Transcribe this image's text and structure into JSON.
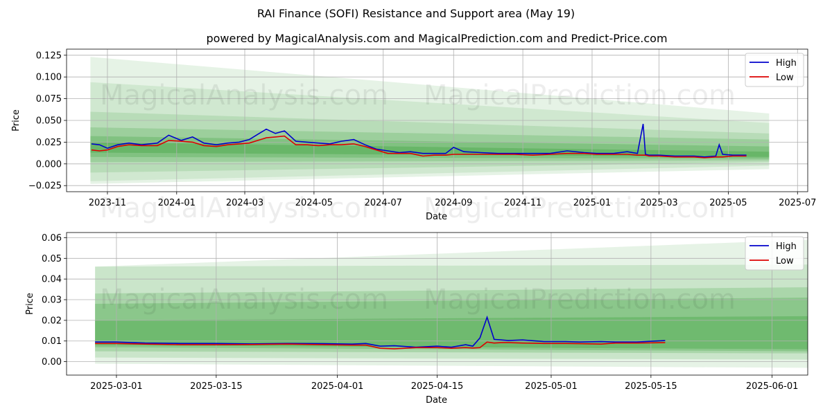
{
  "suptitle": "RAI Finance (SOFI) Resistance and Support area (May 19)",
  "colors": {
    "high": "#0000cc",
    "low": "#dd0000",
    "band": "#2e9b2e",
    "grid": "#b0b0b0"
  },
  "watermarks": [
    "MagicalAnalysis.com",
    "MagicalPrediction.com"
  ],
  "chart_data": [
    {
      "type": "line",
      "title": "powered by MagicalAnalysis.com and MagicalPrediction.com and Predict-Price.com",
      "xlabel": "Date",
      "ylabel": "Price",
      "xlim": [
        "2023-09-26",
        "2025-07-10"
      ],
      "ylim": [
        -0.032,
        0.132
      ],
      "grid": true,
      "legend": "top-right",
      "xticks": [
        "2023-11",
        "2024-01",
        "2024-03",
        "2024-05",
        "2024-07",
        "2024-09",
        "2024-11",
        "2025-01",
        "2025-03",
        "2025-05",
        "2025-07"
      ],
      "yticks": [
        "−0.025",
        "0.000",
        "0.025",
        "0.050",
        "0.075",
        "0.100",
        "0.125"
      ],
      "ytick_values": [
        -0.025,
        0,
        0.025,
        0.05,
        0.075,
        0.1,
        0.125
      ],
      "series": [
        {
          "name": "High",
          "x": [
            "2023-10-18",
            "2023-10-25",
            "2023-11-01",
            "2023-11-10",
            "2023-11-20",
            "2023-12-01",
            "2023-12-15",
            "2023-12-25",
            "2024-01-05",
            "2024-01-15",
            "2024-01-25",
            "2024-02-05",
            "2024-02-15",
            "2024-02-25",
            "2024-03-05",
            "2024-03-15",
            "2024-03-20",
            "2024-03-28",
            "2024-04-05",
            "2024-04-15",
            "2024-04-25",
            "2024-05-05",
            "2024-05-15",
            "2024-05-25",
            "2024-06-05",
            "2024-06-15",
            "2024-06-25",
            "2024-07-05",
            "2024-07-15",
            "2024-07-25",
            "2024-08-05",
            "2024-08-15",
            "2024-08-25",
            "2024-09-01",
            "2024-09-10",
            "2024-09-25",
            "2024-10-10",
            "2024-10-25",
            "2024-11-10",
            "2024-11-25",
            "2024-12-10",
            "2024-12-25",
            "2025-01-05",
            "2025-01-20",
            "2025-02-01",
            "2025-02-10",
            "2025-02-15",
            "2025-02-17",
            "2025-02-20",
            "2025-03-01",
            "2025-03-15",
            "2025-04-01",
            "2025-04-10",
            "2025-04-20",
            "2025-04-23",
            "2025-04-26",
            "2025-05-05",
            "2025-05-17"
          ],
          "values": [
            0.023,
            0.022,
            0.018,
            0.022,
            0.024,
            0.022,
            0.024,
            0.033,
            0.027,
            0.031,
            0.024,
            0.022,
            0.024,
            0.025,
            0.028,
            0.036,
            0.04,
            0.035,
            0.038,
            0.026,
            0.025,
            0.024,
            0.023,
            0.026,
            0.028,
            0.022,
            0.017,
            0.015,
            0.013,
            0.014,
            0.012,
            0.012,
            0.012,
            0.019,
            0.014,
            0.013,
            0.012,
            0.012,
            0.012,
            0.012,
            0.015,
            0.013,
            0.012,
            0.012,
            0.014,
            0.012,
            0.046,
            0.011,
            0.01,
            0.01,
            0.009,
            0.009,
            0.008,
            0.009,
            0.022,
            0.011,
            0.01,
            0.01
          ]
        },
        {
          "name": "Low",
          "x": [
            "2023-10-18",
            "2023-10-25",
            "2023-11-01",
            "2023-11-10",
            "2023-11-20",
            "2023-12-01",
            "2023-12-15",
            "2023-12-25",
            "2024-01-05",
            "2024-01-15",
            "2024-01-25",
            "2024-02-05",
            "2024-02-15",
            "2024-02-25",
            "2024-03-05",
            "2024-03-15",
            "2024-03-20",
            "2024-03-28",
            "2024-04-05",
            "2024-04-15",
            "2024-04-25",
            "2024-05-05",
            "2024-05-15",
            "2024-05-25",
            "2024-06-05",
            "2024-06-15",
            "2024-06-25",
            "2024-07-05",
            "2024-07-15",
            "2024-07-25",
            "2024-08-05",
            "2024-08-15",
            "2024-08-25",
            "2024-09-01",
            "2024-09-10",
            "2024-09-25",
            "2024-10-10",
            "2024-10-25",
            "2024-11-10",
            "2024-11-25",
            "2024-12-10",
            "2024-12-25",
            "2025-01-05",
            "2025-01-20",
            "2025-02-01",
            "2025-02-10",
            "2025-02-15",
            "2025-02-17",
            "2025-02-20",
            "2025-03-01",
            "2025-03-15",
            "2025-04-01",
            "2025-04-10",
            "2025-04-20",
            "2025-04-23",
            "2025-04-26",
            "2025-05-05",
            "2025-05-17"
          ],
          "values": [
            0.016,
            0.015,
            0.016,
            0.02,
            0.022,
            0.021,
            0.021,
            0.027,
            0.026,
            0.025,
            0.021,
            0.02,
            0.022,
            0.023,
            0.024,
            0.028,
            0.03,
            0.031,
            0.032,
            0.022,
            0.022,
            0.021,
            0.022,
            0.022,
            0.023,
            0.02,
            0.016,
            0.012,
            0.012,
            0.012,
            0.009,
            0.01,
            0.01,
            0.011,
            0.011,
            0.011,
            0.011,
            0.011,
            0.01,
            0.011,
            0.012,
            0.012,
            0.011,
            0.011,
            0.011,
            0.01,
            0.01,
            0.01,
            0.009,
            0.009,
            0.008,
            0.008,
            0.007,
            0.008,
            0.008,
            0.008,
            0.009,
            0.009
          ]
        }
      ],
      "bands": [
        {
          "x0": "2023-10-17",
          "x1": "2025-06-06",
          "top": [
            0.123,
            0.058
          ],
          "bottom": [
            -0.023,
            -0.006
          ],
          "opacity": 0.12
        },
        {
          "x0": "2023-10-17",
          "x1": "2025-06-06",
          "top": [
            0.094,
            0.047
          ],
          "bottom": [
            -0.02,
            -0.002
          ],
          "opacity": 0.12
        },
        {
          "x0": "2023-10-17",
          "x1": "2025-06-06",
          "top": [
            0.06,
            0.035
          ],
          "bottom": [
            -0.01,
            0.002
          ],
          "opacity": 0.15
        },
        {
          "x0": "2023-10-17",
          "x1": "2025-06-06",
          "top": [
            0.042,
            0.028
          ],
          "bottom": [
            0.002,
            0.004
          ],
          "opacity": 0.2
        },
        {
          "x0": "2023-10-17",
          "x1": "2025-06-06",
          "top": [
            0.032,
            0.02
          ],
          "bottom": [
            0.008,
            0.006
          ],
          "opacity": 0.25
        },
        {
          "x0": "2023-10-17",
          "x1": "2025-06-06",
          "top": [
            0.025,
            0.014
          ],
          "bottom": [
            0.013,
            0.008
          ],
          "opacity": 0.3
        }
      ]
    },
    {
      "type": "line",
      "title": "",
      "xlabel": "Date",
      "ylabel": "Price",
      "xlim": [
        "2025-02-22",
        "2025-06-06"
      ],
      "ylim": [
        -0.0065,
        0.0625
      ],
      "grid": true,
      "legend": "top-right",
      "xticks": [
        "2025-03-01",
        "2025-03-15",
        "2025-04-01",
        "2025-04-15",
        "2025-05-01",
        "2025-05-15",
        "2025-06-01"
      ],
      "yticks": [
        "0.00",
        "0.01",
        "0.02",
        "0.03",
        "0.04",
        "0.05",
        "0.06"
      ],
      "ytick_values": [
        0,
        0.01,
        0.02,
        0.03,
        0.04,
        0.05,
        0.06
      ],
      "series": [
        {
          "name": "High",
          "x": [
            "2025-02-26",
            "2025-03-01",
            "2025-03-05",
            "2025-03-10",
            "2025-03-15",
            "2025-03-20",
            "2025-03-25",
            "2025-03-30",
            "2025-04-03",
            "2025-04-05",
            "2025-04-07",
            "2025-04-09",
            "2025-04-12",
            "2025-04-15",
            "2025-04-17",
            "2025-04-19",
            "2025-04-20",
            "2025-04-21",
            "2025-04-22",
            "2025-04-23",
            "2025-04-24",
            "2025-04-25",
            "2025-04-27",
            "2025-04-30",
            "2025-05-03",
            "2025-05-05",
            "2025-05-08",
            "2025-05-10",
            "2025-05-13",
            "2025-05-17"
          ],
          "values": [
            0.0095,
            0.0095,
            0.009,
            0.0088,
            0.0088,
            0.0086,
            0.0088,
            0.0087,
            0.0085,
            0.0088,
            0.0075,
            0.0077,
            0.007,
            0.0075,
            0.007,
            0.0082,
            0.0075,
            0.0115,
            0.0215,
            0.0108,
            0.0105,
            0.0102,
            0.0105,
            0.0097,
            0.0097,
            0.0095,
            0.0097,
            0.0095,
            0.0095,
            0.0102
          ]
        },
        {
          "name": "Low",
          "x": [
            "2025-02-26",
            "2025-03-01",
            "2025-03-05",
            "2025-03-10",
            "2025-03-15",
            "2025-03-20",
            "2025-03-25",
            "2025-03-30",
            "2025-04-03",
            "2025-04-05",
            "2025-04-07",
            "2025-04-09",
            "2025-04-12",
            "2025-04-15",
            "2025-04-17",
            "2025-04-19",
            "2025-04-20",
            "2025-04-21",
            "2025-04-22",
            "2025-04-23",
            "2025-04-24",
            "2025-04-25",
            "2025-04-27",
            "2025-04-30",
            "2025-05-03",
            "2025-05-05",
            "2025-05-08",
            "2025-05-10",
            "2025-05-13",
            "2025-05-17"
          ],
          "values": [
            0.0088,
            0.0088,
            0.0085,
            0.0082,
            0.0082,
            0.0083,
            0.0085,
            0.0082,
            0.008,
            0.008,
            0.0065,
            0.0062,
            0.0068,
            0.0068,
            0.0065,
            0.0068,
            0.0066,
            0.0068,
            0.0095,
            0.009,
            0.0092,
            0.0092,
            0.009,
            0.0088,
            0.0088,
            0.0087,
            0.0085,
            0.009,
            0.009,
            0.0092
          ]
        }
      ],
      "bands": [
        {
          "x0": "2025-02-26",
          "x1": "2025-06-06",
          "top": [
            0.046,
            0.059
          ],
          "bottom": [
            -0.001,
            -0.003
          ],
          "opacity": 0.12
        },
        {
          "x0": "2025-02-26",
          "x1": "2025-06-06",
          "top": [
            0.046,
            0.047
          ],
          "bottom": [
            0.002,
            0.001
          ],
          "opacity": 0.15
        },
        {
          "x0": "2025-02-26",
          "x1": "2025-06-06",
          "top": [
            0.033,
            0.036
          ],
          "bottom": [
            0.005,
            0.004
          ],
          "opacity": 0.2
        },
        {
          "x0": "2025-02-26",
          "x1": "2025-06-06",
          "top": [
            0.028,
            0.031
          ],
          "bottom": [
            0.007,
            0.005
          ],
          "opacity": 0.25
        },
        {
          "x0": "2025-02-26",
          "x1": "2025-06-06",
          "top": [
            0.02,
            0.022
          ],
          "bottom": [
            0.008,
            0.006
          ],
          "opacity": 0.3
        }
      ]
    }
  ]
}
